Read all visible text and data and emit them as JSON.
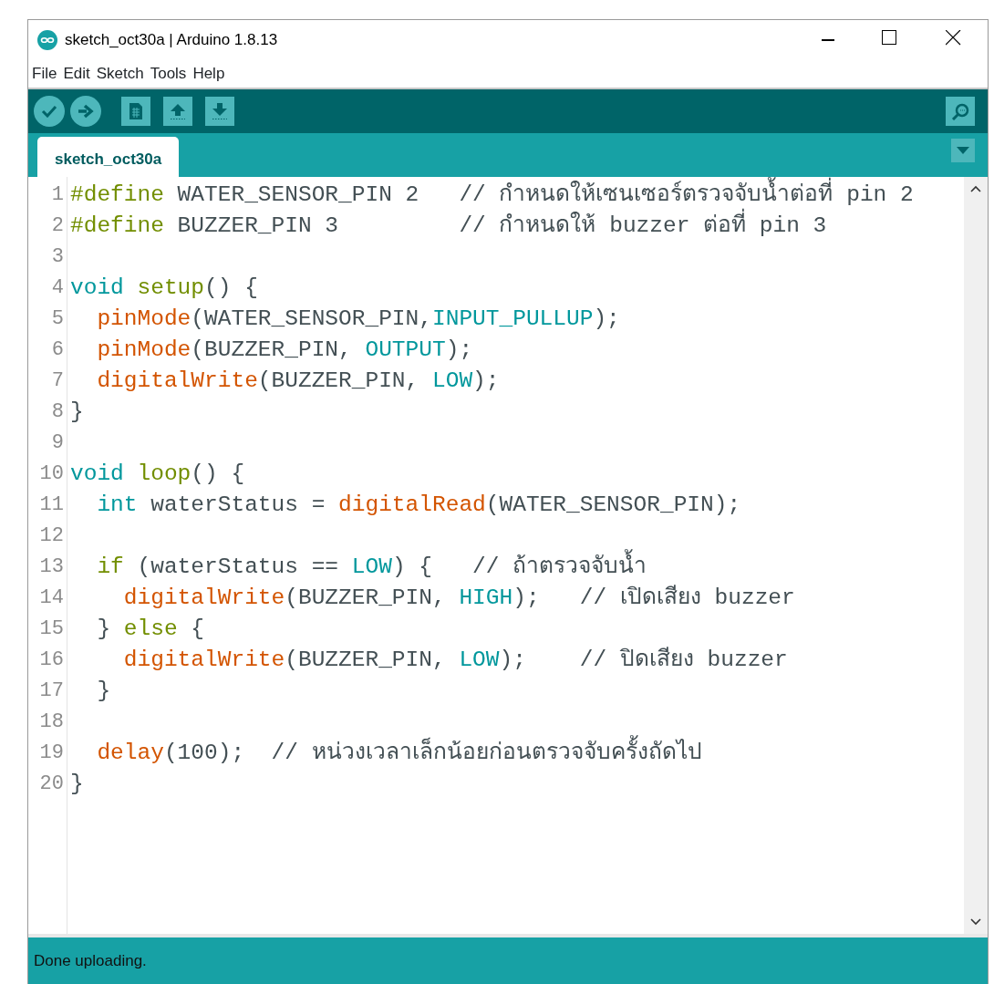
{
  "window": {
    "title": "sketch_oct30a | Arduino 1.8.13"
  },
  "menu": [
    "File",
    "Edit",
    "Sketch",
    "Tools",
    "Help"
  ],
  "tabs": [
    {
      "label": "sketch_oct30a",
      "selected": true
    }
  ],
  "code": [
    {
      "number": "1",
      "tokens": [
        {
          "kind": "preprocessor",
          "text": "#define"
        },
        {
          "kind": "plain",
          "text": " WATER_SENSOR_PIN 2   "
        },
        {
          "kind": "comment",
          "text": "// กำหนดให้เซนเซอร์ตรวจจับน้ำต่อที่ pin 2"
        }
      ]
    },
    {
      "number": "2",
      "tokens": [
        {
          "kind": "preprocessor",
          "text": "#define"
        },
        {
          "kind": "plain",
          "text": " BUZZER_PIN 3         "
        },
        {
          "kind": "comment",
          "text": "// กำหนดให้ buzzer ต่อที่ pin 3"
        }
      ]
    },
    {
      "number": "3"
    },
    {
      "number": "4",
      "tokens": [
        {
          "kind": "type",
          "text": "void"
        },
        {
          "kind": "keyword",
          "text": " setup"
        },
        {
          "kind": "plain",
          "text": "() {"
        }
      ]
    },
    {
      "number": "5",
      "tokens": [
        {
          "kind": "function",
          "text": "  pinMode"
        },
        {
          "kind": "plain",
          "text": "(WATER_SENSOR_PIN,"
        },
        {
          "kind": "constant",
          "text": "INPUT_PULLUP"
        },
        {
          "kind": "plain",
          "text": ");"
        }
      ]
    },
    {
      "number": "6",
      "tokens": [
        {
          "kind": "function",
          "text": "  pinMode"
        },
        {
          "kind": "plain",
          "text": "(BUZZER_PIN, "
        },
        {
          "kind": "constant",
          "text": "OUTPUT"
        },
        {
          "kind": "plain",
          "text": ");"
        }
      ]
    },
    {
      "number": "7",
      "tokens": [
        {
          "kind": "function",
          "text": "  digitalWrite"
        },
        {
          "kind": "plain",
          "text": "(BUZZER_PIN, "
        },
        {
          "kind": "constant",
          "text": "LOW"
        },
        {
          "kind": "plain",
          "text": ");"
        }
      ]
    },
    {
      "number": "8",
      "tokens": [
        {
          "kind": "plain",
          "text": "}"
        }
      ]
    },
    {
      "number": "9"
    },
    {
      "number": "10",
      "tokens": [
        {
          "kind": "type",
          "text": "void"
        },
        {
          "kind": "keyword",
          "text": " loop"
        },
        {
          "kind": "plain",
          "text": "() {"
        }
      ]
    },
    {
      "number": "11",
      "tokens": [
        {
          "kind": "type",
          "text": "  int"
        },
        {
          "kind": "plain",
          "text": " waterStatus = "
        },
        {
          "kind": "function",
          "text": "digitalRead"
        },
        {
          "kind": "plain",
          "text": "(WATER_SENSOR_PIN);"
        }
      ]
    },
    {
      "number": "12"
    },
    {
      "number": "13",
      "tokens": [
        {
          "kind": "keyword",
          "text": "  if"
        },
        {
          "kind": "plain",
          "text": " (waterStatus == "
        },
        {
          "kind": "constant",
          "text": "LOW"
        },
        {
          "kind": "plain",
          "text": ") {   "
        },
        {
          "kind": "comment",
          "text": "// ถ้าตรวจจับน้ำ"
        }
      ]
    },
    {
      "number": "14",
      "tokens": [
        {
          "kind": "function",
          "text": "    digitalWrite"
        },
        {
          "kind": "plain",
          "text": "(BUZZER_PIN, "
        },
        {
          "kind": "constant",
          "text": "HIGH"
        },
        {
          "kind": "plain",
          "text": ");   "
        },
        {
          "kind": "comment",
          "text": "// เปิดเสียง buzzer"
        }
      ]
    },
    {
      "number": "15",
      "tokens": [
        {
          "kind": "plain",
          "text": "  } "
        },
        {
          "kind": "keyword",
          "text": "else"
        },
        {
          "kind": "plain",
          "text": " {"
        }
      ]
    },
    {
      "number": "16",
      "tokens": [
        {
          "kind": "function",
          "text": "    digitalWrite"
        },
        {
          "kind": "plain",
          "text": "(BUZZER_PIN, "
        },
        {
          "kind": "constant",
          "text": "LOW"
        },
        {
          "kind": "plain",
          "text": ");    "
        },
        {
          "kind": "comment",
          "text": "// ปิดเสียง buzzer"
        }
      ]
    },
    {
      "number": "17",
      "tokens": [
        {
          "kind": "plain",
          "text": "  }"
        }
      ]
    },
    {
      "number": "18"
    },
    {
      "number": "19",
      "tokens": [
        {
          "kind": "function",
          "text": "  delay"
        },
        {
          "kind": "plain",
          "text": "(100);  "
        },
        {
          "kind": "comment",
          "text": "// หน่วงเวลาเล็กน้อยก่อนตรวจจับครั้งถัดไป"
        }
      ]
    },
    {
      "number": "20",
      "tokens": [
        {
          "kind": "plain",
          "text": "}"
        }
      ]
    }
  ],
  "status_bar": {
    "message": "Done uploading."
  }
}
